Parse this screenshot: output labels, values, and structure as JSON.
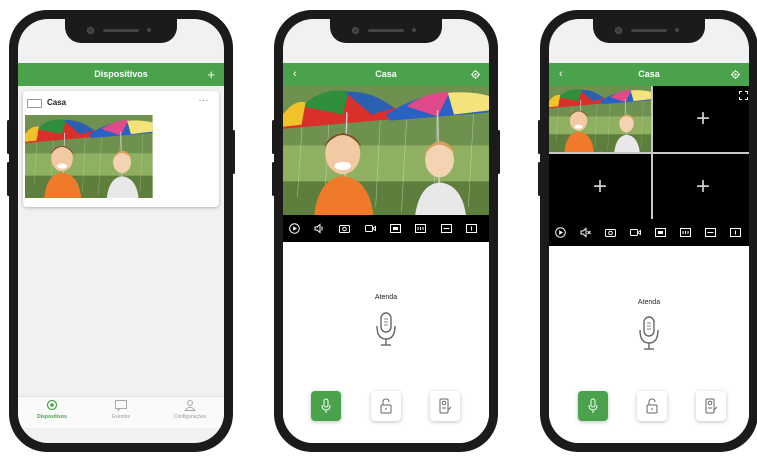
{
  "colors": {
    "accent": "#4aa34c",
    "control_bar": "#000000",
    "phone_frame": "#1b1b1b"
  },
  "phone1": {
    "header": {
      "title": "Dispositivos",
      "add_icon": "+"
    },
    "device": {
      "name": "Casa",
      "menu": "···"
    },
    "nav": [
      {
        "label": "Dispositivos",
        "icon": "camera-icon",
        "active": true
      },
      {
        "label": "Eventos",
        "icon": "message-icon",
        "active": false
      },
      {
        "label": "Configurações",
        "icon": "user-icon",
        "active": false
      }
    ]
  },
  "phone2": {
    "header": {
      "title": "Casa",
      "back_icon": "‹",
      "settings_icon": "gear-icon"
    },
    "controls": [
      "play-icon",
      "speaker-icon",
      "snapshot-icon",
      "record-icon",
      "sd-icon",
      "hd-icon",
      "fit-icon",
      "fullscreen-icon"
    ],
    "answer_label": "Atenda",
    "actions": [
      "mic-icon",
      "unlock-icon",
      "doorbell-icon"
    ]
  },
  "phone3": {
    "header": {
      "title": "Casa",
      "back_icon": "‹",
      "settings_icon": "gear-icon"
    },
    "grid_empty_glyph": "+",
    "controls": [
      "play-icon",
      "mute-icon",
      "snapshot-icon",
      "record-icon",
      "sd-icon",
      "hd-icon",
      "fit-icon",
      "fullscreen-icon"
    ],
    "answer_label": "Atenda",
    "actions": [
      "mic-icon",
      "unlock-icon",
      "doorbell-icon"
    ]
  }
}
